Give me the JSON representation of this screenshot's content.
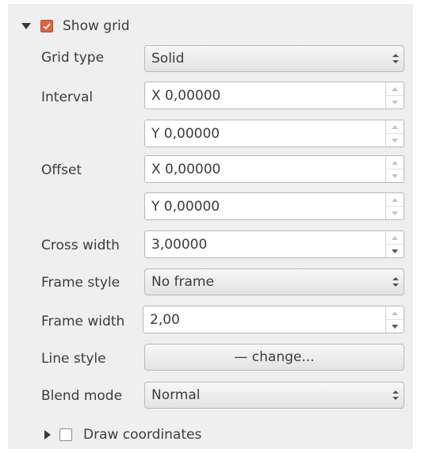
{
  "show_grid": {
    "label": "Show grid",
    "checked": true,
    "expanded": true
  },
  "fields": {
    "grid_type": {
      "label": "Grid type",
      "value": "Solid"
    },
    "interval": {
      "label": "Interval",
      "x": "X 0,00000",
      "y": "Y 0,00000"
    },
    "offset": {
      "label": "Offset",
      "x": "X 0,00000",
      "y": "Y 0,00000"
    },
    "cross_width": {
      "label": "Cross width",
      "value": "3,00000"
    },
    "frame_style": {
      "label": "Frame style",
      "value": "No frame"
    },
    "frame_width": {
      "label": "Frame width",
      "value": "2,00"
    },
    "line_style": {
      "label": "Line style",
      "button": "— change..."
    },
    "blend_mode": {
      "label": "Blend mode",
      "value": "Normal"
    }
  },
  "draw_coordinates": {
    "label": "Draw coordinates",
    "checked": false,
    "expanded": false
  },
  "colors": {
    "checkbox_accent": "#e0613a",
    "panel_bg": "#efefef"
  }
}
